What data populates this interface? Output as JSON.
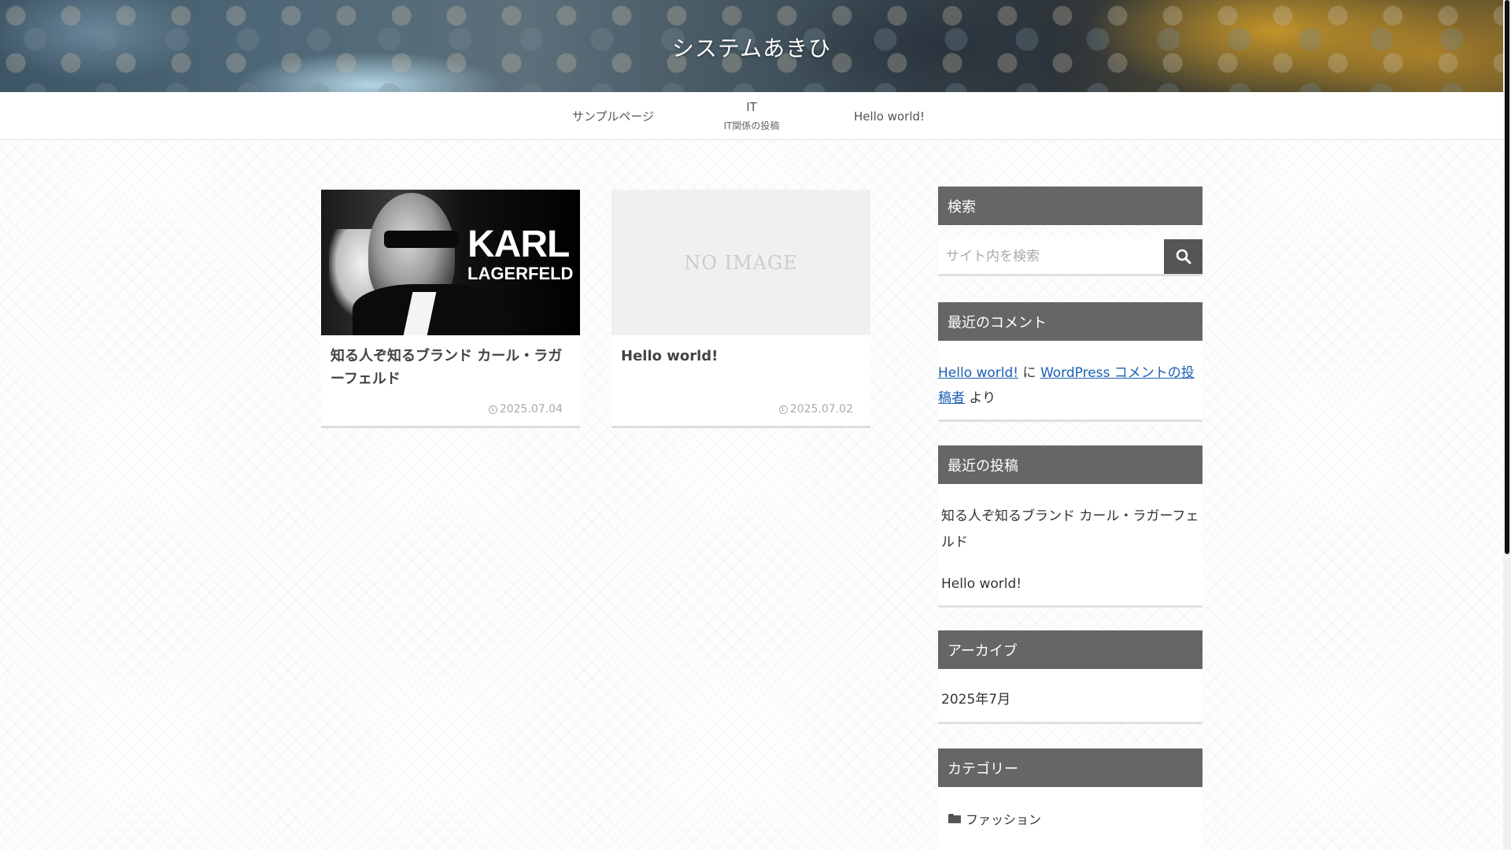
{
  "site": {
    "title": "システムあきひ"
  },
  "nav": [
    {
      "label": "サンプルページ",
      "sub": ""
    },
    {
      "label": "IT",
      "sub": "IT関係の投稿"
    },
    {
      "label": "Hello world!",
      "sub": ""
    }
  ],
  "cards": [
    {
      "title": "知る人ぞ知るブランド カール・ラガーフェルド",
      "date": "2025.07.04",
      "thumb_logo_line1": "KARL",
      "thumb_logo_line2": "LAGERFELD"
    },
    {
      "title": "Hello world!",
      "date": "2025.07.02",
      "thumb_text": "NO IMAGE"
    }
  ],
  "sidebar": {
    "search": {
      "heading": "検索",
      "placeholder": "サイト内を検索",
      "icon": "search-icon"
    },
    "recent_comments": {
      "heading": "最近のコメント",
      "post_link": "Hello world!",
      "connector": "に",
      "author_link": "WordPress コメントの投稿者",
      "suffix": "より"
    },
    "recent_posts": {
      "heading": "最近の投稿",
      "items": [
        "知る人ぞ知るブランド カール・ラガーフェルド",
        "Hello world!"
      ]
    },
    "archives": {
      "heading": "アーカイブ",
      "items": [
        "2025年7月"
      ]
    },
    "categories": {
      "heading": "カテゴリー",
      "items": [
        "ファッション"
      ],
      "icon": "folder-icon"
    }
  },
  "colors": {
    "widget_header": "#666666",
    "link": "#1a5fb4",
    "search_button": "#555555"
  }
}
